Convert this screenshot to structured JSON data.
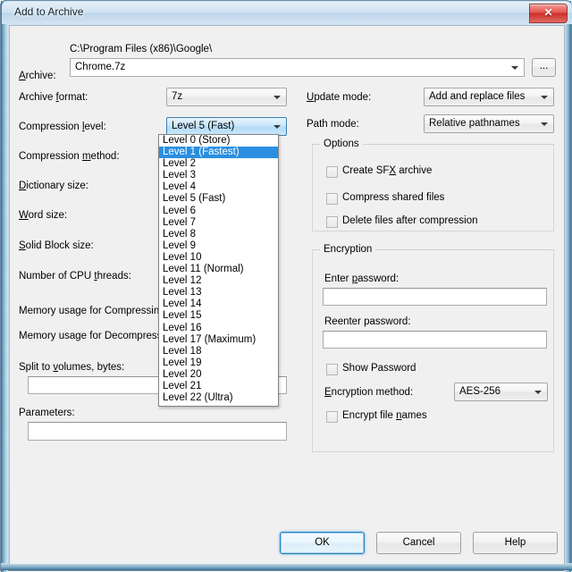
{
  "window": {
    "title": "Add to Archive",
    "close_icon": "close-icon",
    "close_glyph": "✕"
  },
  "archive": {
    "label": "Archive:",
    "label_accel": "A",
    "path_text": "C:\\Program Files (x86)\\Google\\",
    "filename_value": "Chrome.7z",
    "browse_label": "...",
    "browse_name": "browse-button"
  },
  "left_fields": [
    {
      "label": "Archive format:",
      "accel": "f",
      "value": "7z",
      "name": "archive-format",
      "focused": false
    },
    {
      "label": "Compression level:",
      "accel": "l",
      "value": "Level 5 (Fast)",
      "name": "compression-level",
      "focused": true
    },
    {
      "label": "Compression method:",
      "accel": "m",
      "value": "",
      "name": "compression-method",
      "focused": false
    },
    {
      "label": "Dictionary size:",
      "accel": "D",
      "value": "",
      "name": "dictionary-size",
      "focused": false
    },
    {
      "label": "Word size:",
      "accel": "W",
      "value": "",
      "name": "word-size",
      "focused": false
    },
    {
      "label": "Solid Block size:",
      "accel": "S",
      "value": "",
      "name": "solid-block-size",
      "focused": false
    },
    {
      "label": "Number of CPU threads:",
      "accel": "t",
      "value": "",
      "name": "cpu-threads",
      "focused": false
    }
  ],
  "memory": {
    "compressing_label": "Memory usage for Compressing:",
    "compressing_value": "",
    "decompressing_label": "Memory usage for Decompressing:",
    "decompressing_value": ""
  },
  "split": {
    "label": "Split to volumes, bytes:",
    "accel": "v",
    "value": "",
    "name": "split-to-volumes-input"
  },
  "parameters": {
    "label": "Parameters:",
    "value": "",
    "name": "parameters-input"
  },
  "right_fields": [
    {
      "label": "Update mode:",
      "accel": "U",
      "value": "Add and replace files",
      "name": "update-mode"
    },
    {
      "label": "Path mode:",
      "accel": "",
      "value": "Relative pathnames",
      "name": "path-mode"
    }
  ],
  "options": {
    "title": "Options",
    "items": [
      {
        "label": "Create SFX archive",
        "checked": false,
        "name": "create-sfx-archive-checkbox"
      },
      {
        "label": "Compress shared files",
        "checked": false,
        "name": "compress-shared-files-checkbox"
      },
      {
        "label": "Delete files after compression",
        "checked": false,
        "name": "delete-files-after-compression-checkbox"
      }
    ]
  },
  "encryption": {
    "title": "Encryption",
    "enter_password_label": "Enter password:",
    "enter_password_value": "",
    "reenter_password_label": "Reenter password:",
    "reenter_password_value": "",
    "show_password_label": "Show Password",
    "show_password_checked": false,
    "method_label": "Encryption method:",
    "method_value": "AES-256",
    "encrypt_file_names_label": "Encrypt file names",
    "encrypt_file_names_checked": false
  },
  "dropdown": {
    "open": true,
    "selected_index": 1,
    "items": [
      "Level 0 (Store)",
      "Level 1 (Fastest)",
      "Level 2",
      "Level 3",
      "Level 4",
      "Level 5 (Fast)",
      "Level 6",
      "Level 7",
      "Level 8",
      "Level 9",
      "Level 10",
      "Level 11 (Normal)",
      "Level 12",
      "Level 13",
      "Level 14",
      "Level 15",
      "Level 16",
      "Level 17 (Maximum)",
      "Level 18",
      "Level 19",
      "Level 20",
      "Level 21",
      "Level 22 (Ultra)"
    ]
  },
  "footer": {
    "ok_label": "OK",
    "cancel_label": "Cancel",
    "help_label": "Help"
  },
  "colors": {
    "dialog_bg": "#f0f0f0",
    "selection_blue": "#2a8fe0",
    "focus_blue": "#3c7fb1",
    "title_gradient_top": "#e6f0f8",
    "close_red": "#cc2f2a"
  }
}
